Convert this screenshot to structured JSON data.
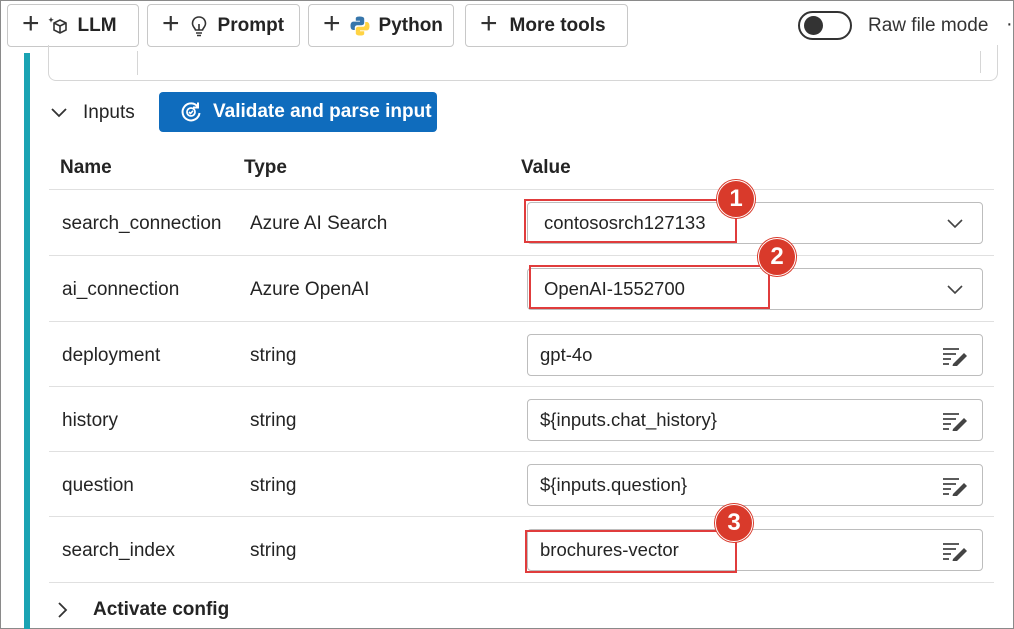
{
  "toolbar": {
    "buttons": [
      {
        "label": "LLM",
        "icon": "llm-cube-icon"
      },
      {
        "label": "Prompt",
        "icon": "lightbulb-icon"
      },
      {
        "label": "Python",
        "icon": "python-icon"
      },
      {
        "label": "More tools",
        "icon": "plus-icon"
      }
    ],
    "raw_file_mode_label": "Raw file mode",
    "more_glyph": "·"
  },
  "inputs": {
    "section_label": "Inputs",
    "validate_label": "Validate and parse input",
    "headers": {
      "name": "Name",
      "type": "Type",
      "value": "Value"
    },
    "rows": [
      {
        "name": "search_connection",
        "type": "Azure AI Search",
        "value": "contososrch127133",
        "control": "dropdown"
      },
      {
        "name": "ai_connection",
        "type": "Azure OpenAI",
        "value": "OpenAI-1552700",
        "control": "dropdown"
      },
      {
        "name": "deployment",
        "type": "string",
        "value": "gpt-4o",
        "control": "text"
      },
      {
        "name": "history",
        "type": "string",
        "value": "${inputs.chat_history}",
        "control": "text"
      },
      {
        "name": "question",
        "type": "string",
        "value": "${inputs.question}",
        "control": "text"
      },
      {
        "name": "search_index",
        "type": "string",
        "value": "brochures-vector",
        "control": "text"
      }
    ]
  },
  "annotations": [
    "1",
    "2",
    "3"
  ],
  "activate_config_label": "Activate config",
  "colors": {
    "accent": "#0f6cbd",
    "rail": "#1aa3b3",
    "annotation": "#d93a2b"
  }
}
